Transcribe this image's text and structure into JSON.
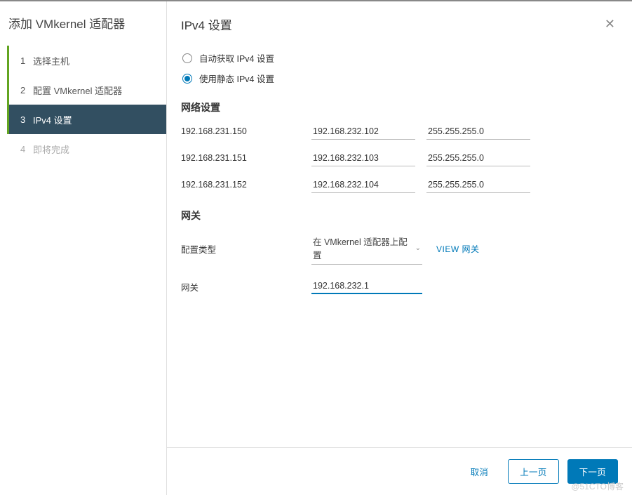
{
  "sidebar": {
    "title": "添加 VMkernel 适配器",
    "steps": [
      {
        "num": "1",
        "label": "选择主机",
        "state": "done"
      },
      {
        "num": "2",
        "label": "配置 VMkernel 适配器",
        "state": "done"
      },
      {
        "num": "3",
        "label": "IPv4 设置",
        "state": "active"
      },
      {
        "num": "4",
        "label": "即将完成",
        "state": "future"
      }
    ]
  },
  "main": {
    "title": "IPv4 设置",
    "radios": {
      "auto": "自动获取 IPv4 设置",
      "static": "使用静态 IPv4 设置",
      "selected": "static"
    },
    "network_heading": "网络设置",
    "rows": [
      {
        "host": "192.168.231.150",
        "ip": "192.168.232.102",
        "mask": "255.255.255.0"
      },
      {
        "host": "192.168.231.151",
        "ip": "192.168.232.103",
        "mask": "255.255.255.0"
      },
      {
        "host": "192.168.231.152",
        "ip": "192.168.232.104",
        "mask": "255.255.255.0"
      }
    ],
    "gateway_heading": "网关",
    "config_type_label": "配置类型",
    "config_type_value": "在 VMkernel 适配器上配置",
    "view_gateway": "VIEW 网关",
    "gateway_label": "网关",
    "gateway_value": "192.168.232.1"
  },
  "footer": {
    "cancel": "取消",
    "back": "上一页",
    "next": "下一页"
  },
  "watermark": "@51CTO博客"
}
